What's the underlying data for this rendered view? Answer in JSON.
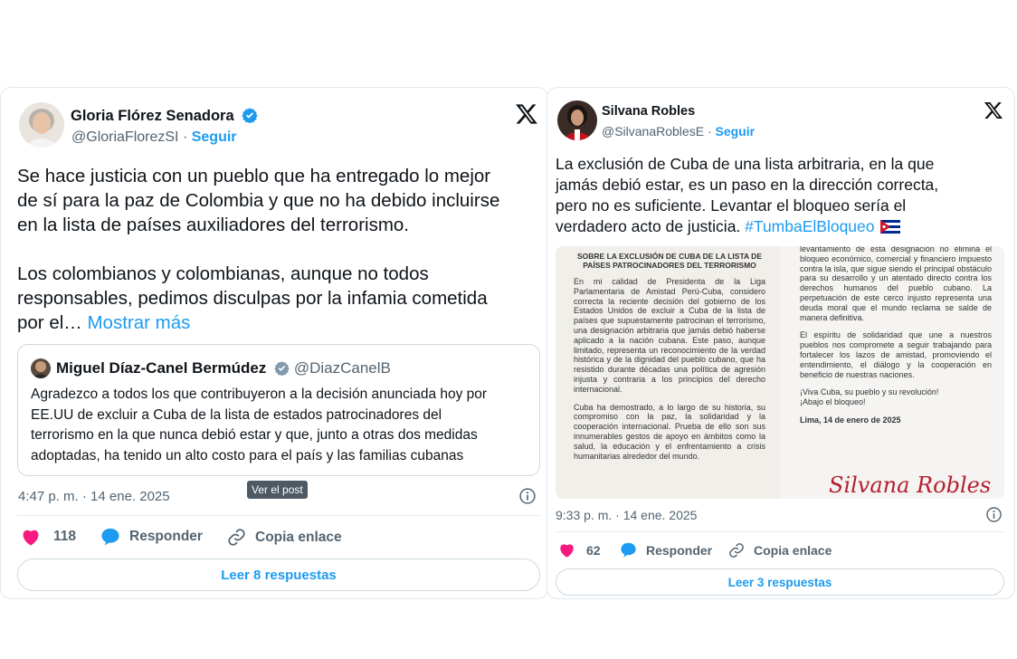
{
  "left_post": {
    "author_name": "Gloria Flórez Senadora",
    "handle": "@GloriaFlorezSI",
    "separator": "·",
    "follow_label": "Seguir",
    "body_lines": [
      "Se hace justicia con un pueblo que ha entregado lo mejor",
      "de sí para la paz de Colombia y que no ha debido incluirse",
      "en la lista de países auxiliadores del terrorismo.",
      "",
      "Los colombianos y colombianas, aunque no todos",
      "responsables, pedimos disculpas por la infamia cometida"
    ],
    "body_last_line": "por el…",
    "show_more": "Mostrar más",
    "quote": {
      "author_name": "Miguel Díaz-Canel Bermúdez",
      "handle": "@DiazCanelB",
      "lines": [
        "Agradezco a todos los que contribuyeron a la decisión anunciada hoy por",
        "EE.UU de excluir a Cuba de la lista de estados patrocinadores del",
        "terrorismo en la que nunca debió estar y que, junto a otras dos medidas",
        "adoptadas, ha tenido un alto costo para el país y las familias cubanas"
      ]
    },
    "timestamp": "4:47 p. m. · 14 ene. 2025",
    "tooltip": "Ver el post",
    "likes": "118",
    "reply_label": "Responder",
    "copy_label": "Copia enlace",
    "read_replies": "Leer 8 respuestas"
  },
  "right_post": {
    "author_name": "Silvana Robles",
    "handle": "@SilvanaRoblesE",
    "separator": "·",
    "follow_label": "Seguir",
    "body_lines": [
      "La exclusión de Cuba de una lista arbitraria, en la que",
      "jamás debió estar, es un paso en la dirección correcta,",
      "pero no es suficiente. Levantar el bloqueo sería el"
    ],
    "body_last_prefix": "verdadero acto de justicia.",
    "hashtag": "#TumbaElBloqueo",
    "document": {
      "title": "SOBRE LA EXCLUSIÓN DE CUBA DE LA LISTA DE PAÍSES PATROCINADORES DEL TERRORISMO",
      "left_paragraphs": [
        "En mi calidad de Presidenta de la Liga Parlamentaria de Amistad Perú-Cuba, considero correcta la reciente decisión del gobierno de los Estados Unidos de excluir a Cuba de la lista de países que supuestamente patrocinan el terrorismo, una designación arbitraria que jamás debió haberse aplicado a la nación cubana. Este paso, aunque limitado, representa un reconocimiento de la verdad histórica y de la dignidad del pueblo cubano, que ha resistido durante décadas una política de agresión injusta y contraria a los principios del derecho internacional.",
        "Cuba ha demostrado, a lo largo de su historia, su compromiso con la paz, la solidaridad y la cooperación internacional. Prueba de ello son sus innumerables gestos de apoyo en ámbitos como la salud, la educación y el enfrentamiento a crisis humanitarias alrededor del mundo."
      ],
      "right_paragraphs": [
        "levantamiento de esta designación no elimina el bloqueo económico, comercial y financiero impuesto contra la isla, que sigue siendo el principal obstáculo para su desarrollo y un atentado directo contra los derechos humanos del pueblo cubano. La perpetuación de este cerco injusto representa una deuda moral que el mundo reclama se salde de manera definitiva.",
        "El espíritu de solidaridad que une a nuestros pueblos nos compromete a seguir trabajando para fortalecer los lazos de amistad, promoviendo el entendimiento, el diálogo y la cooperación en beneficio de nuestras naciones.",
        "¡Viva Cuba, su pueblo y su revolución!\n¡Abajo el bloqueo!",
        "Lima, 14 de enero de 2025"
      ],
      "signature": "Silvana Robles"
    },
    "timestamp": "9:33 p. m. · 14 ene. 2025",
    "likes": "62",
    "reply_label": "Responder",
    "copy_label": "Copia enlace",
    "read_replies": "Leer 3 respuestas"
  },
  "colors": {
    "blue": "#1d9bf0",
    "like": "#f91880",
    "muted": "#536471",
    "text": "#0f1419"
  }
}
